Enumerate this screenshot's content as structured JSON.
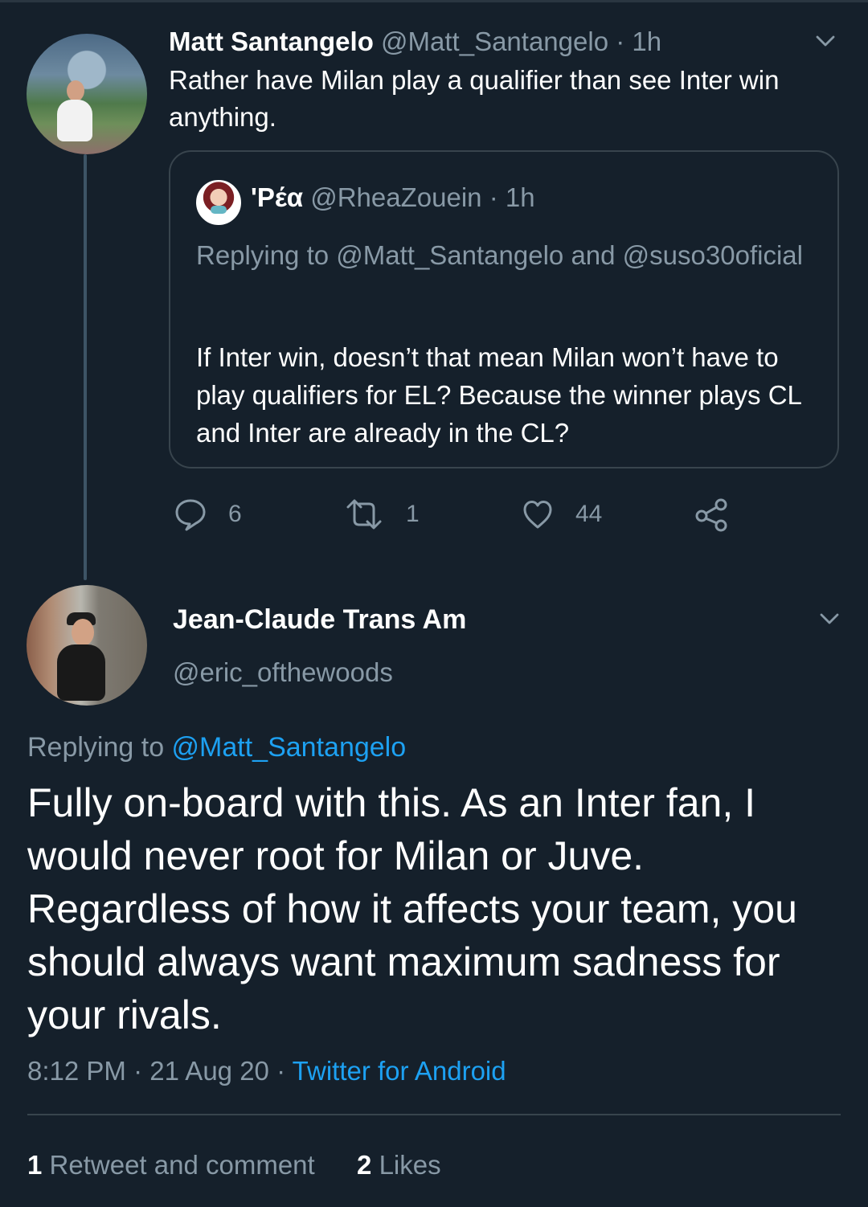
{
  "tweet1": {
    "name": "Matt Santangelo",
    "handle": "@Matt_Santangelo",
    "separator": "·",
    "time": "1h",
    "text": "Rather have Milan play a qualifier than see Inter win anything."
  },
  "quote": {
    "name": "'Ρέα",
    "handle": "@RheaZouein",
    "separator": "·",
    "time": "1h",
    "replying_prefix": "Replying to ",
    "replying_users": "@Matt_Santangelo and @suso30oficial",
    "text": "If Inter win, doesn’t that mean Milan won’t have to play qualifiers for EL? Because the winner plays CL and Inter are already in the CL?"
  },
  "actions": {
    "reply_count": "6",
    "retweet_count": "1",
    "like_count": "44"
  },
  "tweet2": {
    "name": "Jean-Claude Trans Am",
    "handle": "@eric_ofthewoods",
    "replying_prefix": "Replying to ",
    "replying_to": "@Matt_Santangelo",
    "text": "Fully on-board with this. As an Inter fan, I would never root for Milan or Juve. Regardless of how it affects your team, you should always want maximum sadness for your rivals.",
    "time": "8:12 PM",
    "separator1": "·",
    "date": "21 Aug 20",
    "separator2": "·",
    "client": "Twitter for Android"
  },
  "stats": {
    "retweets_count": "1",
    "retweets_label": "Retweet and comment",
    "likes_count": "2",
    "likes_label": "Likes"
  },
  "icons": {
    "chevron": "chevron-down-icon",
    "reply": "reply-icon",
    "retweet": "retweet-icon",
    "like": "heart-icon",
    "share": "share-icon"
  },
  "colors": {
    "background": "#15202b",
    "text": "#ffffff",
    "muted": "#8899a6",
    "accent": "#1da1f2",
    "border": "#38444d"
  }
}
